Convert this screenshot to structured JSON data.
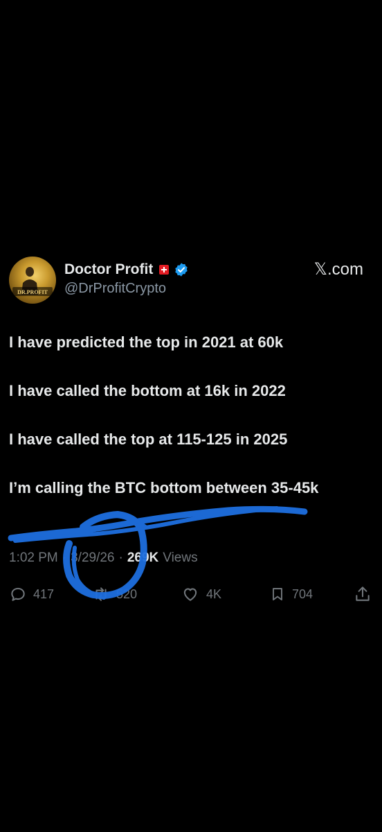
{
  "author": {
    "display_name": "Doctor Profit",
    "handle": "@DrProfitCrypto",
    "avatar_text": "DR.PROFIT",
    "flag_icon": "swiss-flag-icon",
    "verified_icon": "verified-badge-icon",
    "verified_color": "#1d9bf0"
  },
  "brand": {
    "label": "𝕏.com"
  },
  "tweet": {
    "lines": [
      "I have predicted the top in 2021 at 60k",
      "I have called the bottom at 16k in 2022",
      "I have called the top at 115-125 in 2025",
      "I’m calling the BTC bottom between 35-45k"
    ]
  },
  "meta": {
    "time": "1:02 PM",
    "separator": "·",
    "date": "3/29/26",
    "views_count": "269K",
    "views_label": "Views"
  },
  "actions": {
    "replies": {
      "icon": "reply-icon",
      "count": "417"
    },
    "reposts": {
      "icon": "repost-icon",
      "count": "520"
    },
    "likes": {
      "icon": "heart-icon",
      "count": "4K"
    },
    "bookmarks": {
      "icon": "bookmark-icon",
      "count": "704"
    },
    "share": {
      "icon": "share-icon"
    }
  },
  "annotation": {
    "color": "#1e6fe0"
  }
}
